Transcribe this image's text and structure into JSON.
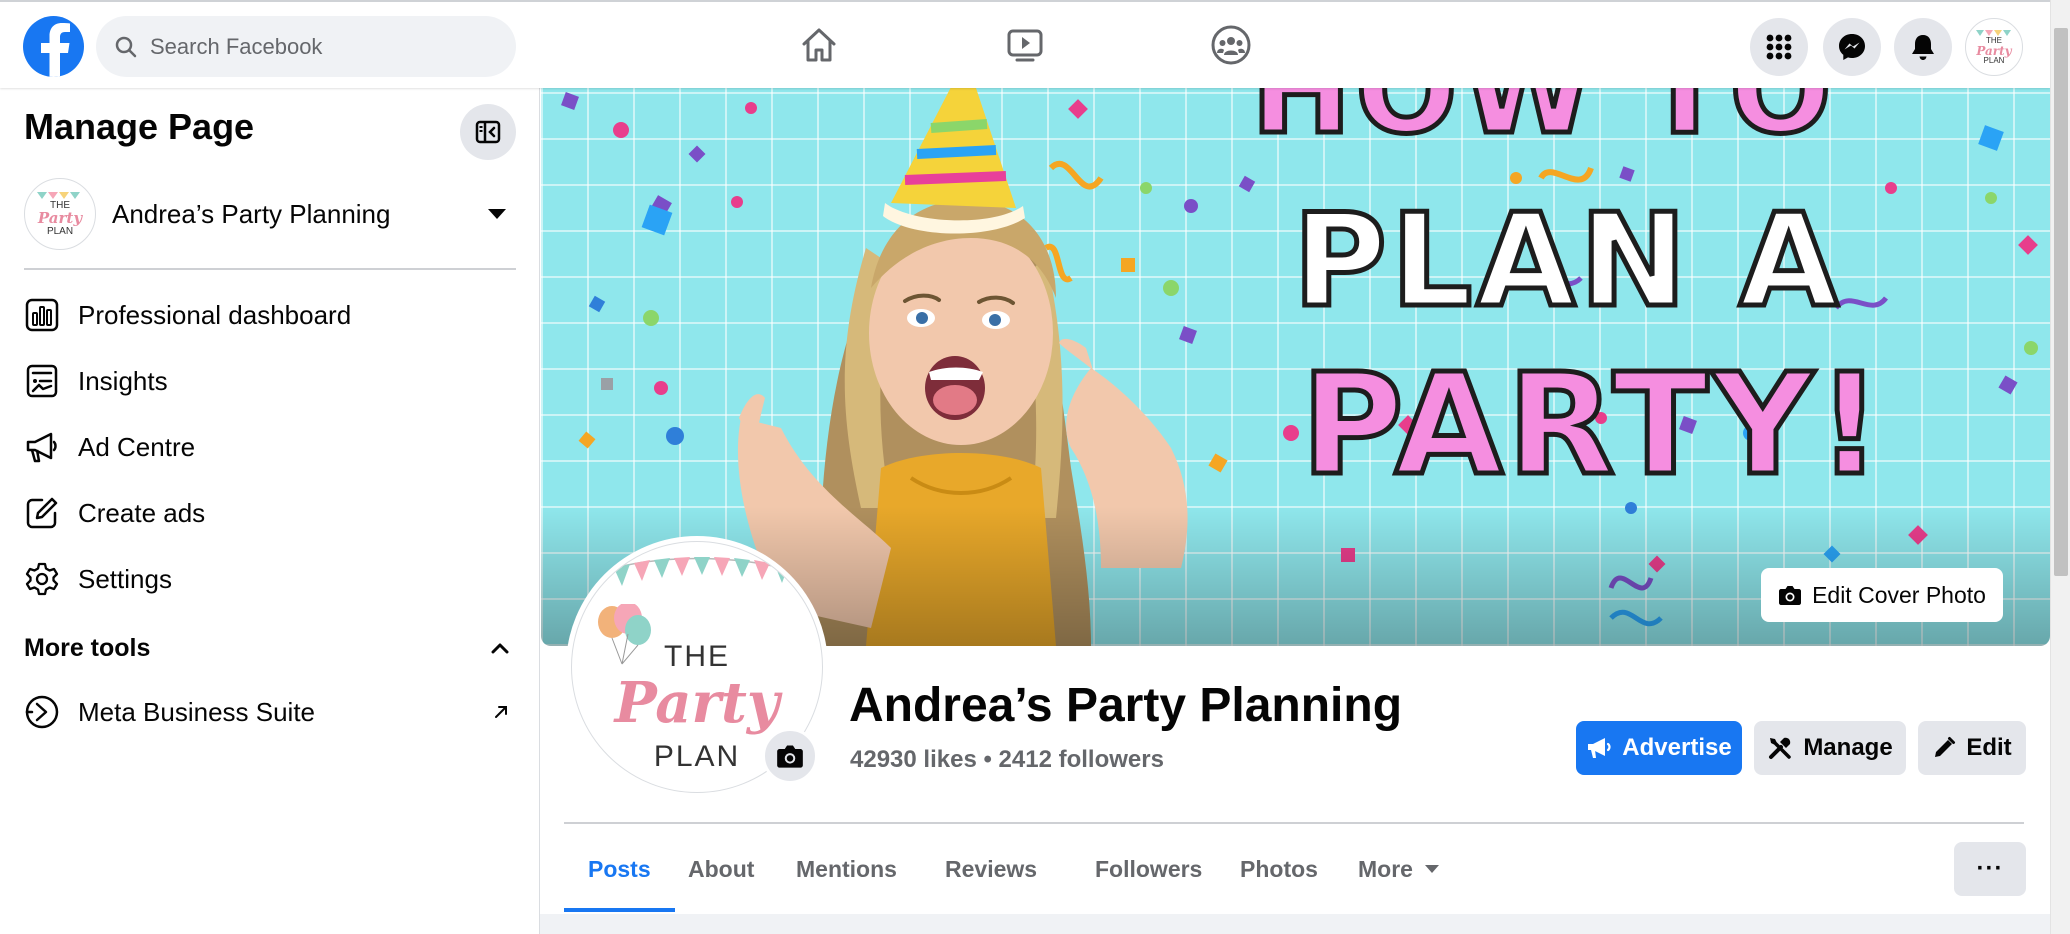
{
  "topnav": {
    "logo_glyph": "f",
    "search_placeholder": "Search Facebook",
    "icons": [
      "home-icon",
      "video-icon",
      "groups-icon",
      "menu-grid-icon",
      "messenger-icon",
      "notifications-icon",
      "profile-avatar"
    ],
    "avatar_text": {
      "line1": "THE",
      "line2": "Party",
      "line3": "PLAN"
    }
  },
  "sidebar": {
    "title": "Manage Page",
    "page_name": "Andrea’s Party Planning",
    "avatar_text": {
      "line1": "THE",
      "line2": "Party",
      "line3": "PLAN"
    },
    "items": [
      {
        "label": "Professional dashboard",
        "icon": "dashboard-icon"
      },
      {
        "label": "Insights",
        "icon": "insights-icon"
      },
      {
        "label": "Ad Centre",
        "icon": "megaphone-icon"
      },
      {
        "label": "Create ads",
        "icon": "create-ads-icon"
      },
      {
        "label": "Settings",
        "icon": "gear-icon"
      }
    ],
    "more_tools_label": "More tools",
    "tools": [
      {
        "label": "Meta Business Suite",
        "icon": "meta-business-suite-icon"
      }
    ]
  },
  "cover": {
    "text_line1": "HOW TO",
    "text_line2": "PLAN A",
    "text_line3": "PARTY!",
    "edit_cover_label": "Edit Cover Photo",
    "colors": {
      "background": "#8fe7ec",
      "pink_text": "#f58ee0",
      "white_text": "#ffffff"
    }
  },
  "profile": {
    "avatar_text": {
      "line1": "THE",
      "line2": "Party",
      "line3": "PLAN"
    },
    "page_title": "Andrea’s Party Planning",
    "stats": "42930 likes • 2412 followers",
    "buttons": {
      "advertise": "Advertise",
      "manage": "Manage",
      "edit": "Edit"
    }
  },
  "tabs": {
    "items": [
      "Posts",
      "About",
      "Mentions",
      "Reviews",
      "Followers",
      "Photos",
      "More"
    ],
    "active": "Posts",
    "overflow_label": "···"
  },
  "colors": {
    "brand": "#1877f2",
    "secondary_button": "#e4e6eb",
    "muted_text": "#65676b",
    "page_bg": "#f0f2f5"
  }
}
